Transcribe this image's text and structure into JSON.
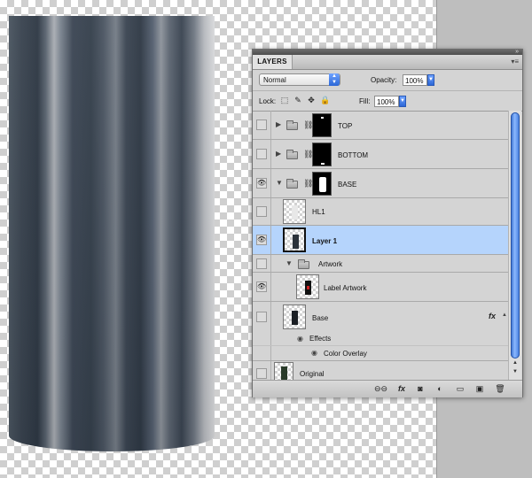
{
  "panel": {
    "tab_label": "LAYERS",
    "menu_icon": "panel-menu-icon",
    "blend_mode": "Normal",
    "opacity_label": "Opacity:",
    "opacity_value": "100%",
    "lock_label": "Lock:",
    "fill_label": "Fill:",
    "fill_value": "100%"
  },
  "layers": [
    {
      "name": "TOP",
      "type": "group",
      "visible": false,
      "expanded": false
    },
    {
      "name": "BOTTOM",
      "type": "group",
      "visible": false,
      "expanded": false
    },
    {
      "name": "BASE",
      "type": "group",
      "visible": true,
      "expanded": true
    },
    {
      "name": "HL1",
      "type": "layer",
      "visible": false
    },
    {
      "name": "Layer 1",
      "type": "layer",
      "visible": true,
      "selected": true
    },
    {
      "name": "Artwork",
      "type": "group",
      "visible": false,
      "expanded": true
    },
    {
      "name": "Label Artwork",
      "type": "layer",
      "visible": true
    },
    {
      "name": "Base",
      "type": "layer",
      "visible": false,
      "fx": "fx"
    },
    {
      "name": "Effects",
      "type": "effects-header"
    },
    {
      "name": "Color Overlay",
      "type": "effect"
    },
    {
      "name": "Original",
      "type": "layer",
      "visible": false
    }
  ],
  "bottom_icons": [
    "link-icon",
    "fx-icon",
    "mask-icon",
    "adjustment-icon",
    "new-group-icon",
    "new-layer-icon",
    "trash-icon"
  ],
  "fx_label": "fx"
}
